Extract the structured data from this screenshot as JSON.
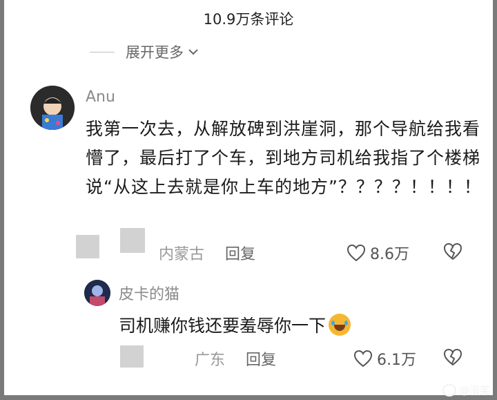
{
  "header": {
    "comment_count": "10.9万条评论"
  },
  "expand": {
    "label": "展开更多"
  },
  "comment": {
    "username": "Anu",
    "text": "我第一次去，从解放碑到洪崖洞，那个导航给我看懵了，最后打了个车，到地方司机给我指了个楼梯说“从这上去就是你上车的地方”？？？？！！！！",
    "location": "内蒙古",
    "reply_label": "回复",
    "likes": "8.6万"
  },
  "reply": {
    "username": "皮卡的猫",
    "text": "司机赚你钱还要羞辱你一下",
    "location": "广东",
    "reply_label": "回复",
    "likes": "6.1万"
  },
  "watermark": {
    "text": "@溺笑"
  }
}
